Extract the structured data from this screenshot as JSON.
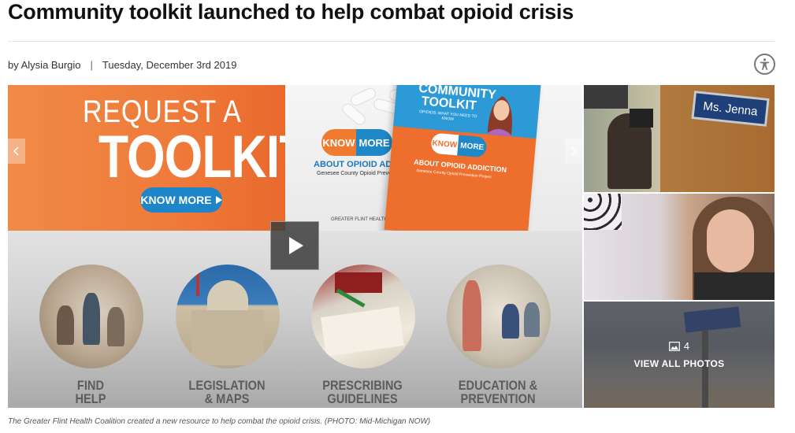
{
  "article": {
    "headline": "Community toolkit launched to help combat opioid crisis",
    "byline_author": "by Alysia Burgio",
    "byline_separator": "|",
    "byline_date": "Tuesday, December 3rd 2019"
  },
  "hero": {
    "banner_request": "REQUEST A",
    "banner_toolkit": "TOOLKIT",
    "banner_button": "KNOW MORE",
    "logo_know": "KNOW",
    "logo_more": "MORE",
    "about_text": "ABOUT OPIOID ADDICTION",
    "county_text": "Genesee County Opioid Prevention Project",
    "org_text": "GREATER FLINT HEALTH COALITION",
    "book_title": "COMMUNITY TOOLKIT",
    "book_subtitle": "OPIOIDS: WHAT YOU NEED TO KNOW",
    "book_logo_know": "KNOW",
    "book_logo_more": "MORE",
    "book_about": "ABOUT OPIOID ADDICTION",
    "book_county": "Genesee County Opioid Prevention Project",
    "categories": [
      {
        "line1": "FIND",
        "line2": "HELP"
      },
      {
        "line1": "LEGISLATION",
        "line2": "& MAPS"
      },
      {
        "line1": "PRESCRIBING",
        "line2": "GUIDELINES"
      },
      {
        "line1": "EDUCATION &",
        "line2": "PREVENTION"
      }
    ]
  },
  "thumbnails": {
    "nameplate": "Ms. Jenna",
    "photo_count": "4",
    "view_all": "VIEW ALL PHOTOS"
  },
  "caption": "The Greater Flint Health Coalition created a new resource to help combat the opioid crisis. (PHOTO: Mid-Michigan NOW)",
  "icons": {
    "accessibility": "accessibility-icon",
    "play": "play-icon",
    "prev": "chevron-left-icon",
    "next": "chevron-right-icon",
    "gallery": "image-icon"
  },
  "colors": {
    "banner_orange": "#ef7b3a",
    "button_blue": "#1e86c8",
    "label_gray": "#5c5c5c"
  }
}
